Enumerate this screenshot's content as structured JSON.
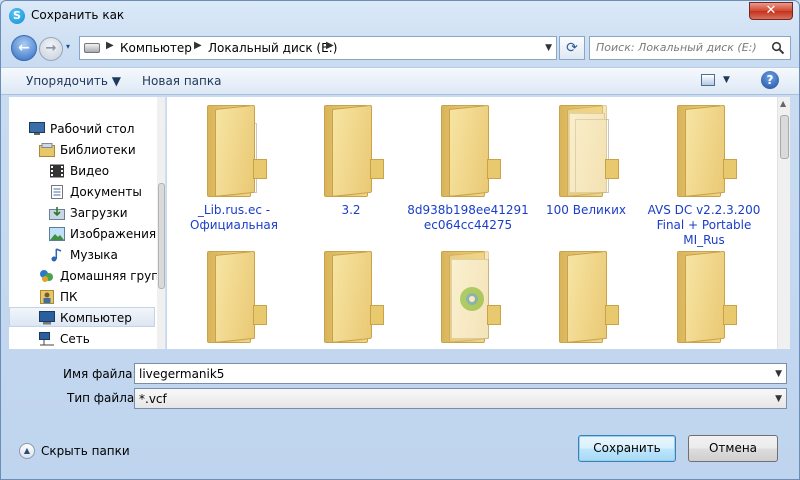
{
  "window": {
    "title": "Сохранить как",
    "close_label": "✕",
    "app_icon_letter": "S"
  },
  "nav": {
    "back_label": "←",
    "forward_label": "→",
    "history_label": "▾",
    "breadcrumbs": [
      "Компьютер",
      "Локальный диск (E:)"
    ],
    "separator": "▶",
    "dropdown": "▼",
    "refresh_label": "⟳",
    "search_placeholder": "Поиск: Локальный диск (E:)"
  },
  "toolbar": {
    "organize": "Упорядочить ▼",
    "new_folder": "Новая папка",
    "views_dropdown": "▼",
    "help": "?"
  },
  "sidebar": {
    "items": [
      {
        "label": "Рабочий стол",
        "icon": "desktop-icon"
      },
      {
        "label": "Библиотеки",
        "icon": "libraries-icon"
      },
      {
        "label": "Видео",
        "icon": "video-icon"
      },
      {
        "label": "Документы",
        "icon": "documents-icon"
      },
      {
        "label": "Загрузки",
        "icon": "downloads-icon"
      },
      {
        "label": "Изображения",
        "icon": "pictures-icon"
      },
      {
        "label": "Музыка",
        "icon": "music-icon"
      },
      {
        "label": "Домашняя груп",
        "icon": "homegroup-icon"
      },
      {
        "label": "ПК",
        "icon": "pc-icon"
      },
      {
        "label": "Компьютер",
        "icon": "computer-icon",
        "selected": true
      },
      {
        "label": "Сеть",
        "icon": "network-icon"
      }
    ]
  },
  "files": [
    {
      "label": "_Lib.rus.ec - Официальная",
      "icon": "folder-icon"
    },
    {
      "label": "3.2",
      "icon": "folder-icon"
    },
    {
      "label": "8d938b198ee41291ec064cc44275",
      "icon": "folder-icon"
    },
    {
      "label": "100 Великих",
      "icon": "folder-icon"
    },
    {
      "label": "AVS DC v2.2.3.200 Final + Portable MI_Rus",
      "icon": "folder-icon"
    },
    {
      "label": "",
      "icon": "folder-icon"
    },
    {
      "label": "",
      "icon": "folder-icon"
    },
    {
      "label": "",
      "icon": "folder-icon"
    },
    {
      "label": "",
      "icon": "folder-icon"
    },
    {
      "label": "",
      "icon": "folder-icon"
    }
  ],
  "form": {
    "filename_label": "Имя файла:",
    "filename_value": "livegermanik5",
    "filetype_label": "Тип файла:",
    "filetype_value": "*.vcf",
    "dropdown": "▼"
  },
  "footer": {
    "hide_folders": "Скрыть папки",
    "hide_icon_glyph": "▲",
    "save": "Сохранить",
    "cancel": "Отмена"
  }
}
